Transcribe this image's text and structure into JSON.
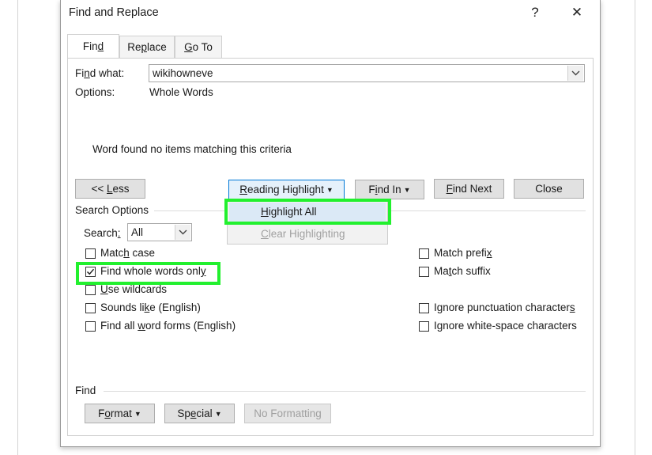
{
  "dialog": {
    "title": "Find and Replace",
    "help_label": "?",
    "close_label": "✕"
  },
  "tabs": [
    {
      "pre": "Fin",
      "key": "d",
      "post": ""
    },
    {
      "pre": "Re",
      "key": "p",
      "post": "lace"
    },
    {
      "pre": "",
      "key": "G",
      "post": "o To"
    }
  ],
  "find": {
    "label_pre": "Fi",
    "label_key": "n",
    "label_post": "d what:",
    "value": "wikihowneve",
    "options_label": "Options:",
    "options_value": "Whole Words",
    "message": "Word found no items matching this criteria"
  },
  "buttons": {
    "less": {
      "pre": "<< ",
      "key": "L",
      "post": "ess"
    },
    "reading_highlight": {
      "pre": "",
      "key": "R",
      "post": "eading Highlight"
    },
    "find_in": {
      "pre": "F",
      "key": "i",
      "post": "nd In"
    },
    "find_next": {
      "pre": "",
      "key": "F",
      "post": "ind Next"
    },
    "close": "Close"
  },
  "menu": {
    "highlight_all": {
      "pre": "",
      "key": "H",
      "post": "ighlight All"
    },
    "clear_highlighting": {
      "pre": "",
      "key": "C",
      "post": "lear Highlighting"
    }
  },
  "search_options": {
    "heading": "Search Options",
    "search_label_pre": "Search",
    "search_label_key": ":",
    "search_value": "All",
    "left": [
      {
        "pre": "Matc",
        "key": "h",
        "post": " case",
        "checked": false
      },
      {
        "pre": "Find whole words onl",
        "key": "y",
        "post": "",
        "checked": true
      },
      {
        "pre": "",
        "key": "U",
        "post": "se wildcards",
        "checked": false
      },
      {
        "pre": "Sounds li",
        "key": "k",
        "post": "e (English)",
        "checked": false
      },
      {
        "pre": "Find all ",
        "key": "w",
        "post": "ord forms (English)",
        "checked": false
      }
    ],
    "right": [
      {
        "pre": "Match prefi",
        "key": "x",
        "post": "",
        "checked": false
      },
      {
        "pre": "Ma",
        "key": "t",
        "post": "ch suffix",
        "checked": false
      },
      {
        "pre": "Ignore punctuation character",
        "key": "s",
        "post": "",
        "checked": false
      },
      {
        "pre": "Ignore white-space characters",
        "key": "",
        "post": "",
        "checked": false
      }
    ]
  },
  "find_section": {
    "heading": "Find",
    "format": {
      "pre": "F",
      "key": "o",
      "post": "rmat"
    },
    "special": {
      "pre": "Sp",
      "key": "e",
      "post": "cial"
    },
    "no_formatting": "No Formatting"
  },
  "colors": {
    "highlight_border": "#22f02e",
    "focus_border": "#0078d7",
    "menu_selected": "#dbe9f6"
  }
}
